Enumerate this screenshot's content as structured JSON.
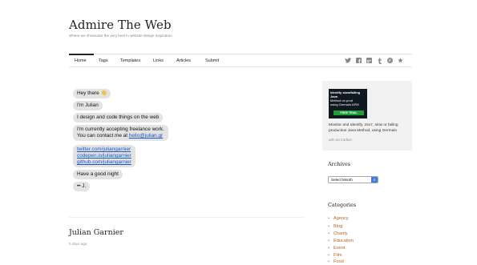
{
  "site": {
    "title": "Admire The Web",
    "tagline": "Where we showcase the very best in website design inspiration"
  },
  "nav": {
    "items": [
      "Home",
      "Tags",
      "Templates",
      "Links",
      "Articles",
      "Submit"
    ],
    "active": "Home",
    "social_icons": [
      "twitter-icon",
      "facebook-icon",
      "google-plus-icon",
      "tumblr-icon",
      "pinterest-icon",
      "star-icon"
    ]
  },
  "chat": {
    "bubbles": {
      "hey": "Hey there 👋",
      "name": "I'm Julian",
      "design": "I design and code things on the web",
      "freelance_1": "I'm currently accepting freelance work.",
      "freelance_2_prefix": "You can contact me at ",
      "email": "hello@julian.gr",
      "link_twitter": "twitter.com/juliangarnier",
      "link_codepen": "codepen.io/juliangarnier",
      "link_github": "github.com/juliangarnier",
      "night": "Have a good night",
      "sign": "•• J."
    }
  },
  "post": {
    "title": "Julian Garnier",
    "date": "5 days ago"
  },
  "ad": {
    "image_lines": [
      "Identify slow/failing",
      "Java",
      "Method on prod",
      "using Germain APM"
    ],
    "button": "FREE TRIAL",
    "text": "Monitor and Identify, 24x7, slow or failing production Java Method, using Germain",
    "via": "ads via Carbon"
  },
  "archives": {
    "title": "Archives",
    "select_value": "Select Month"
  },
  "categories": {
    "title": "Categories",
    "items": [
      "Agency",
      "Blog",
      "Charity",
      "Education",
      "Event",
      "Film",
      "Food"
    ]
  }
}
